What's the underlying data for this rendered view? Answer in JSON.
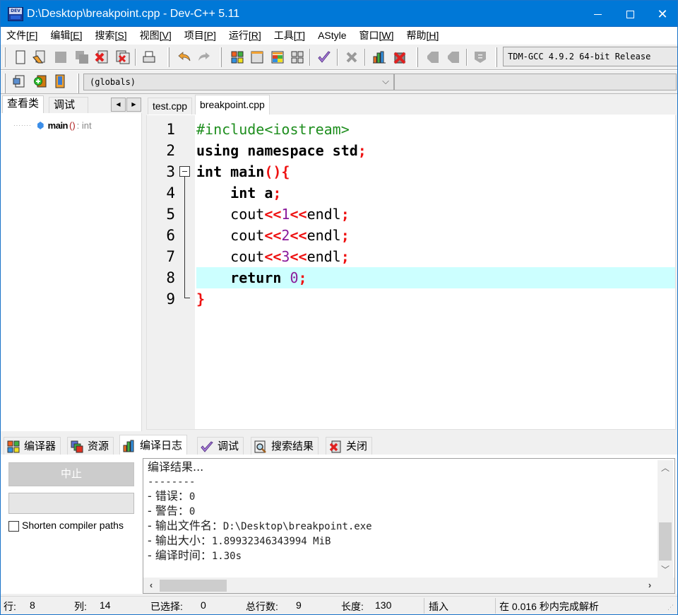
{
  "window": {
    "title": "D:\\Desktop\\breakpoint.cpp - Dev-C++ 5.11",
    "app_icon_text": "DEV",
    "controls": {
      "minimize": "minimize",
      "maximize": "maximize",
      "close": "close"
    }
  },
  "menu": [
    {
      "label": "文件",
      "key": "[F]"
    },
    {
      "label": "编辑",
      "key": "[E]"
    },
    {
      "label": "搜索",
      "key": "[S]"
    },
    {
      "label": "视图",
      "key": "[V]"
    },
    {
      "label": "项目",
      "key": "[P]"
    },
    {
      "label": "运行",
      "key": "[R]"
    },
    {
      "label": "工具",
      "key": "[T]"
    },
    {
      "label": "AStyle",
      "key": ""
    },
    {
      "label": "窗口",
      "key": "[W]"
    },
    {
      "label": "帮助",
      "key": "[H]"
    }
  ],
  "toolbar": {
    "compiler": "TDM-GCC 4.9.2 64-bit Release",
    "scope": "(globals)",
    "symbol": ""
  },
  "left_panel": {
    "tabs": [
      "查看类",
      "调试"
    ],
    "active_tab": 0,
    "tree": [
      {
        "name": "main",
        "params": "()",
        "type": ": int"
      }
    ]
  },
  "editor": {
    "tabs": [
      "test.cpp",
      "breakpoint.cpp"
    ],
    "active_tab": 1,
    "highlighted_line": 8,
    "lines": [
      {
        "n": "1",
        "tokens": [
          [
            "pp",
            "#include<iostream>"
          ]
        ]
      },
      {
        "n": "2",
        "tokens": [
          [
            "kw",
            "using namespace std"
          ],
          [
            "sy",
            ";"
          ]
        ]
      },
      {
        "n": "3",
        "tokens": [
          [
            "kw",
            "int main"
          ],
          [
            "sy",
            "(){"
          ]
        ]
      },
      {
        "n": "4",
        "tokens": [
          [
            "kw",
            "    int a"
          ],
          [
            "sy",
            ";"
          ]
        ]
      },
      {
        "n": "5",
        "tokens": [
          [
            "pl",
            "    cout"
          ],
          [
            "sy",
            "<<"
          ],
          [
            "nu",
            "1"
          ],
          [
            "sy",
            "<<"
          ],
          [
            "pl",
            "endl"
          ],
          [
            "sy",
            ";"
          ]
        ]
      },
      {
        "n": "6",
        "tokens": [
          [
            "pl",
            "    cout"
          ],
          [
            "sy",
            "<<"
          ],
          [
            "nu",
            "2"
          ],
          [
            "sy",
            "<<"
          ],
          [
            "pl",
            "endl"
          ],
          [
            "sy",
            ";"
          ]
        ]
      },
      {
        "n": "7",
        "tokens": [
          [
            "pl",
            "    cout"
          ],
          [
            "sy",
            "<<"
          ],
          [
            "nu",
            "3"
          ],
          [
            "sy",
            "<<"
          ],
          [
            "pl",
            "endl"
          ],
          [
            "sy",
            ";"
          ]
        ]
      },
      {
        "n": "8",
        "tokens": [
          [
            "kw",
            "    return "
          ],
          [
            "nu",
            "0"
          ],
          [
            "sy",
            ";"
          ]
        ]
      },
      {
        "n": "9",
        "tokens": [
          [
            "sy",
            "}"
          ]
        ]
      }
    ]
  },
  "bottom_panel": {
    "tabs": [
      {
        "label": "编译器",
        "icon": "compiler-grid-icon"
      },
      {
        "label": "资源",
        "icon": "resources-icon"
      },
      {
        "label": "编译日志",
        "icon": "bar-chart-icon"
      },
      {
        "label": "调试",
        "icon": "checkmark-icon"
      },
      {
        "label": "搜索结果",
        "icon": "search-results-icon"
      },
      {
        "label": "关闭",
        "icon": "close-panel-icon"
      }
    ],
    "active_tab": 2,
    "stop_button": "中止",
    "shorten_label": "Shorten compiler paths",
    "shorten_checked": false,
    "log": [
      {
        "cn": "编译结果...",
        "val": ""
      },
      {
        "cn": "",
        "val": "--------"
      },
      {
        "cn": "- 错误：",
        "val": "0"
      },
      {
        "cn": "- 警告：",
        "val": "0"
      },
      {
        "cn": "- 输出文件名：",
        "val": "D:\\Desktop\\breakpoint.exe"
      },
      {
        "cn": "- 输出大小：",
        "val": "1.89932346343994 MiB"
      },
      {
        "cn": "- 编译时间：",
        "val": "1.30s"
      }
    ]
  },
  "status": {
    "row_label": "行:",
    "row": "8",
    "col_label": "列:",
    "col": "14",
    "sel_label": "已选择:",
    "sel": "0",
    "total_label": "总行数:",
    "total": "9",
    "len_label": "长度:",
    "len": "130",
    "mode": "插入",
    "parse": "在 0.016 秒内完成解析"
  }
}
